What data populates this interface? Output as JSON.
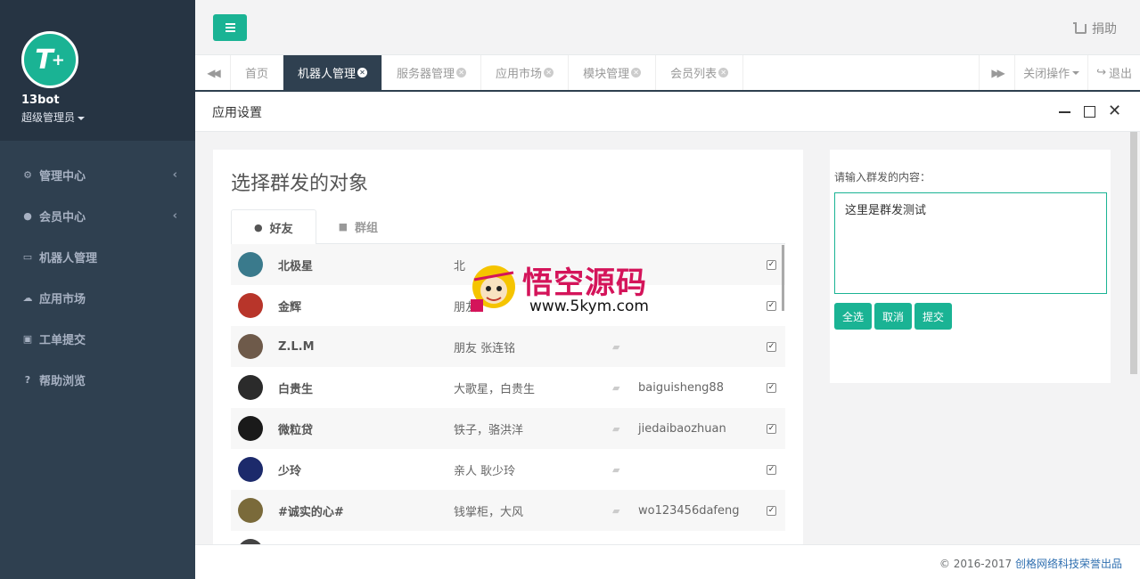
{
  "sidebar": {
    "logo_text": "T",
    "logo_plus": "+",
    "username": "13bot",
    "role": "超级管理员",
    "nav": [
      {
        "label": "管理中心",
        "icon": "gear-icon",
        "has_arrow": true
      },
      {
        "label": "会员中心",
        "icon": "user-icon",
        "has_arrow": true
      },
      {
        "label": "机器人管理",
        "icon": "desktop-icon",
        "has_arrow": false
      },
      {
        "label": "应用市场",
        "icon": "cloud-icon",
        "has_arrow": false
      },
      {
        "label": "工单提交",
        "icon": "calendar-plus-icon",
        "has_arrow": false
      },
      {
        "label": "帮助浏览",
        "icon": "question-icon",
        "has_arrow": false
      }
    ]
  },
  "topbar": {
    "donate_label": "捐助"
  },
  "tabs": {
    "items": [
      {
        "label": "首页",
        "closable": false,
        "active": false
      },
      {
        "label": "机器人管理",
        "closable": true,
        "active": true
      },
      {
        "label": "服务器管理",
        "closable": true,
        "active": false
      },
      {
        "label": "应用市场",
        "closable": true,
        "active": false
      },
      {
        "label": "模块管理",
        "closable": true,
        "active": false
      },
      {
        "label": "会员列表",
        "closable": true,
        "active": false
      }
    ],
    "close_ops_label": "关闭操作",
    "logout_label": "退出"
  },
  "window": {
    "title": "应用设置"
  },
  "left_panel": {
    "title": "选择群发的对象",
    "tab_friends": "好友",
    "tab_groups": "群组",
    "friends": [
      {
        "name": "北极星",
        "note": "北",
        "wechat_id": "",
        "checked": true,
        "avatar_color": "#3a7a8c"
      },
      {
        "name": "金辉",
        "note": "朋友",
        "wechat_id": "",
        "checked": true,
        "avatar_color": "#b8352a"
      },
      {
        "name": "Z.L.M",
        "note": "朋友 张连铭",
        "wechat_id": "",
        "checked": true,
        "avatar_color": "#6e5a4a"
      },
      {
        "name": "白贵生",
        "note": "大歌星，白贵生",
        "wechat_id": "baiguisheng88",
        "checked": true,
        "avatar_color": "#2b2b2b"
      },
      {
        "name": "微粒贷",
        "note": "铁子，骆洪洋",
        "wechat_id": "jiedaibaozhuan",
        "checked": true,
        "avatar_color": "#1a1a1a"
      },
      {
        "name": "少玲",
        "note": "亲人 耿少玲",
        "wechat_id": "",
        "checked": true,
        "avatar_color": "#1c2a6b"
      },
      {
        "name": "#诚实的心#",
        "note": "钱掌柜，大风",
        "wechat_id": "wo123456dafeng",
        "checked": true,
        "avatar_color": "#7a6a3a"
      }
    ]
  },
  "right_panel": {
    "label": "请输入群发的内容：",
    "content": "这里是群发测试",
    "btn_select_all": "全选",
    "btn_cancel": "取消",
    "btn_submit": "提交"
  },
  "footer": {
    "copyright": "© 2016-2017",
    "company": "创格网络科技荣誉出品"
  },
  "watermark": {
    "title": "悟空源码",
    "url": "www.5kym.com"
  },
  "colors": {
    "accent": "#1ab394",
    "sidebar": "#2f4050",
    "sidebar_dark": "#263443"
  }
}
